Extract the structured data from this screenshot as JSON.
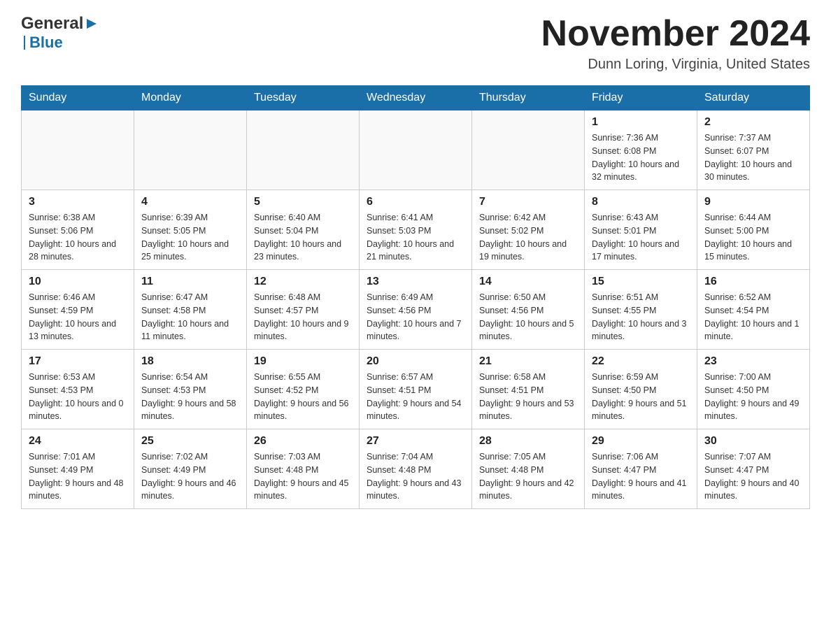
{
  "header": {
    "logo_general": "General",
    "logo_blue": "Blue",
    "month_title": "November 2024",
    "location": "Dunn Loring, Virginia, United States"
  },
  "days_of_week": [
    "Sunday",
    "Monday",
    "Tuesday",
    "Wednesday",
    "Thursday",
    "Friday",
    "Saturday"
  ],
  "weeks": [
    [
      {
        "day": "",
        "sunrise": "",
        "sunset": "",
        "daylight": ""
      },
      {
        "day": "",
        "sunrise": "",
        "sunset": "",
        "daylight": ""
      },
      {
        "day": "",
        "sunrise": "",
        "sunset": "",
        "daylight": ""
      },
      {
        "day": "",
        "sunrise": "",
        "sunset": "",
        "daylight": ""
      },
      {
        "day": "",
        "sunrise": "",
        "sunset": "",
        "daylight": ""
      },
      {
        "day": "1",
        "sunrise": "Sunrise: 7:36 AM",
        "sunset": "Sunset: 6:08 PM",
        "daylight": "Daylight: 10 hours and 32 minutes."
      },
      {
        "day": "2",
        "sunrise": "Sunrise: 7:37 AM",
        "sunset": "Sunset: 6:07 PM",
        "daylight": "Daylight: 10 hours and 30 minutes."
      }
    ],
    [
      {
        "day": "3",
        "sunrise": "Sunrise: 6:38 AM",
        "sunset": "Sunset: 5:06 PM",
        "daylight": "Daylight: 10 hours and 28 minutes."
      },
      {
        "day": "4",
        "sunrise": "Sunrise: 6:39 AM",
        "sunset": "Sunset: 5:05 PM",
        "daylight": "Daylight: 10 hours and 25 minutes."
      },
      {
        "day": "5",
        "sunrise": "Sunrise: 6:40 AM",
        "sunset": "Sunset: 5:04 PM",
        "daylight": "Daylight: 10 hours and 23 minutes."
      },
      {
        "day": "6",
        "sunrise": "Sunrise: 6:41 AM",
        "sunset": "Sunset: 5:03 PM",
        "daylight": "Daylight: 10 hours and 21 minutes."
      },
      {
        "day": "7",
        "sunrise": "Sunrise: 6:42 AM",
        "sunset": "Sunset: 5:02 PM",
        "daylight": "Daylight: 10 hours and 19 minutes."
      },
      {
        "day": "8",
        "sunrise": "Sunrise: 6:43 AM",
        "sunset": "Sunset: 5:01 PM",
        "daylight": "Daylight: 10 hours and 17 minutes."
      },
      {
        "day": "9",
        "sunrise": "Sunrise: 6:44 AM",
        "sunset": "Sunset: 5:00 PM",
        "daylight": "Daylight: 10 hours and 15 minutes."
      }
    ],
    [
      {
        "day": "10",
        "sunrise": "Sunrise: 6:46 AM",
        "sunset": "Sunset: 4:59 PM",
        "daylight": "Daylight: 10 hours and 13 minutes."
      },
      {
        "day": "11",
        "sunrise": "Sunrise: 6:47 AM",
        "sunset": "Sunset: 4:58 PM",
        "daylight": "Daylight: 10 hours and 11 minutes."
      },
      {
        "day": "12",
        "sunrise": "Sunrise: 6:48 AM",
        "sunset": "Sunset: 4:57 PM",
        "daylight": "Daylight: 10 hours and 9 minutes."
      },
      {
        "day": "13",
        "sunrise": "Sunrise: 6:49 AM",
        "sunset": "Sunset: 4:56 PM",
        "daylight": "Daylight: 10 hours and 7 minutes."
      },
      {
        "day": "14",
        "sunrise": "Sunrise: 6:50 AM",
        "sunset": "Sunset: 4:56 PM",
        "daylight": "Daylight: 10 hours and 5 minutes."
      },
      {
        "day": "15",
        "sunrise": "Sunrise: 6:51 AM",
        "sunset": "Sunset: 4:55 PM",
        "daylight": "Daylight: 10 hours and 3 minutes."
      },
      {
        "day": "16",
        "sunrise": "Sunrise: 6:52 AM",
        "sunset": "Sunset: 4:54 PM",
        "daylight": "Daylight: 10 hours and 1 minute."
      }
    ],
    [
      {
        "day": "17",
        "sunrise": "Sunrise: 6:53 AM",
        "sunset": "Sunset: 4:53 PM",
        "daylight": "Daylight: 10 hours and 0 minutes."
      },
      {
        "day": "18",
        "sunrise": "Sunrise: 6:54 AM",
        "sunset": "Sunset: 4:53 PM",
        "daylight": "Daylight: 9 hours and 58 minutes."
      },
      {
        "day": "19",
        "sunrise": "Sunrise: 6:55 AM",
        "sunset": "Sunset: 4:52 PM",
        "daylight": "Daylight: 9 hours and 56 minutes."
      },
      {
        "day": "20",
        "sunrise": "Sunrise: 6:57 AM",
        "sunset": "Sunset: 4:51 PM",
        "daylight": "Daylight: 9 hours and 54 minutes."
      },
      {
        "day": "21",
        "sunrise": "Sunrise: 6:58 AM",
        "sunset": "Sunset: 4:51 PM",
        "daylight": "Daylight: 9 hours and 53 minutes."
      },
      {
        "day": "22",
        "sunrise": "Sunrise: 6:59 AM",
        "sunset": "Sunset: 4:50 PM",
        "daylight": "Daylight: 9 hours and 51 minutes."
      },
      {
        "day": "23",
        "sunrise": "Sunrise: 7:00 AM",
        "sunset": "Sunset: 4:50 PM",
        "daylight": "Daylight: 9 hours and 49 minutes."
      }
    ],
    [
      {
        "day": "24",
        "sunrise": "Sunrise: 7:01 AM",
        "sunset": "Sunset: 4:49 PM",
        "daylight": "Daylight: 9 hours and 48 minutes."
      },
      {
        "day": "25",
        "sunrise": "Sunrise: 7:02 AM",
        "sunset": "Sunset: 4:49 PM",
        "daylight": "Daylight: 9 hours and 46 minutes."
      },
      {
        "day": "26",
        "sunrise": "Sunrise: 7:03 AM",
        "sunset": "Sunset: 4:48 PM",
        "daylight": "Daylight: 9 hours and 45 minutes."
      },
      {
        "day": "27",
        "sunrise": "Sunrise: 7:04 AM",
        "sunset": "Sunset: 4:48 PM",
        "daylight": "Daylight: 9 hours and 43 minutes."
      },
      {
        "day": "28",
        "sunrise": "Sunrise: 7:05 AM",
        "sunset": "Sunset: 4:48 PM",
        "daylight": "Daylight: 9 hours and 42 minutes."
      },
      {
        "day": "29",
        "sunrise": "Sunrise: 7:06 AM",
        "sunset": "Sunset: 4:47 PM",
        "daylight": "Daylight: 9 hours and 41 minutes."
      },
      {
        "day": "30",
        "sunrise": "Sunrise: 7:07 AM",
        "sunset": "Sunset: 4:47 PM",
        "daylight": "Daylight: 9 hours and 40 minutes."
      }
    ]
  ]
}
